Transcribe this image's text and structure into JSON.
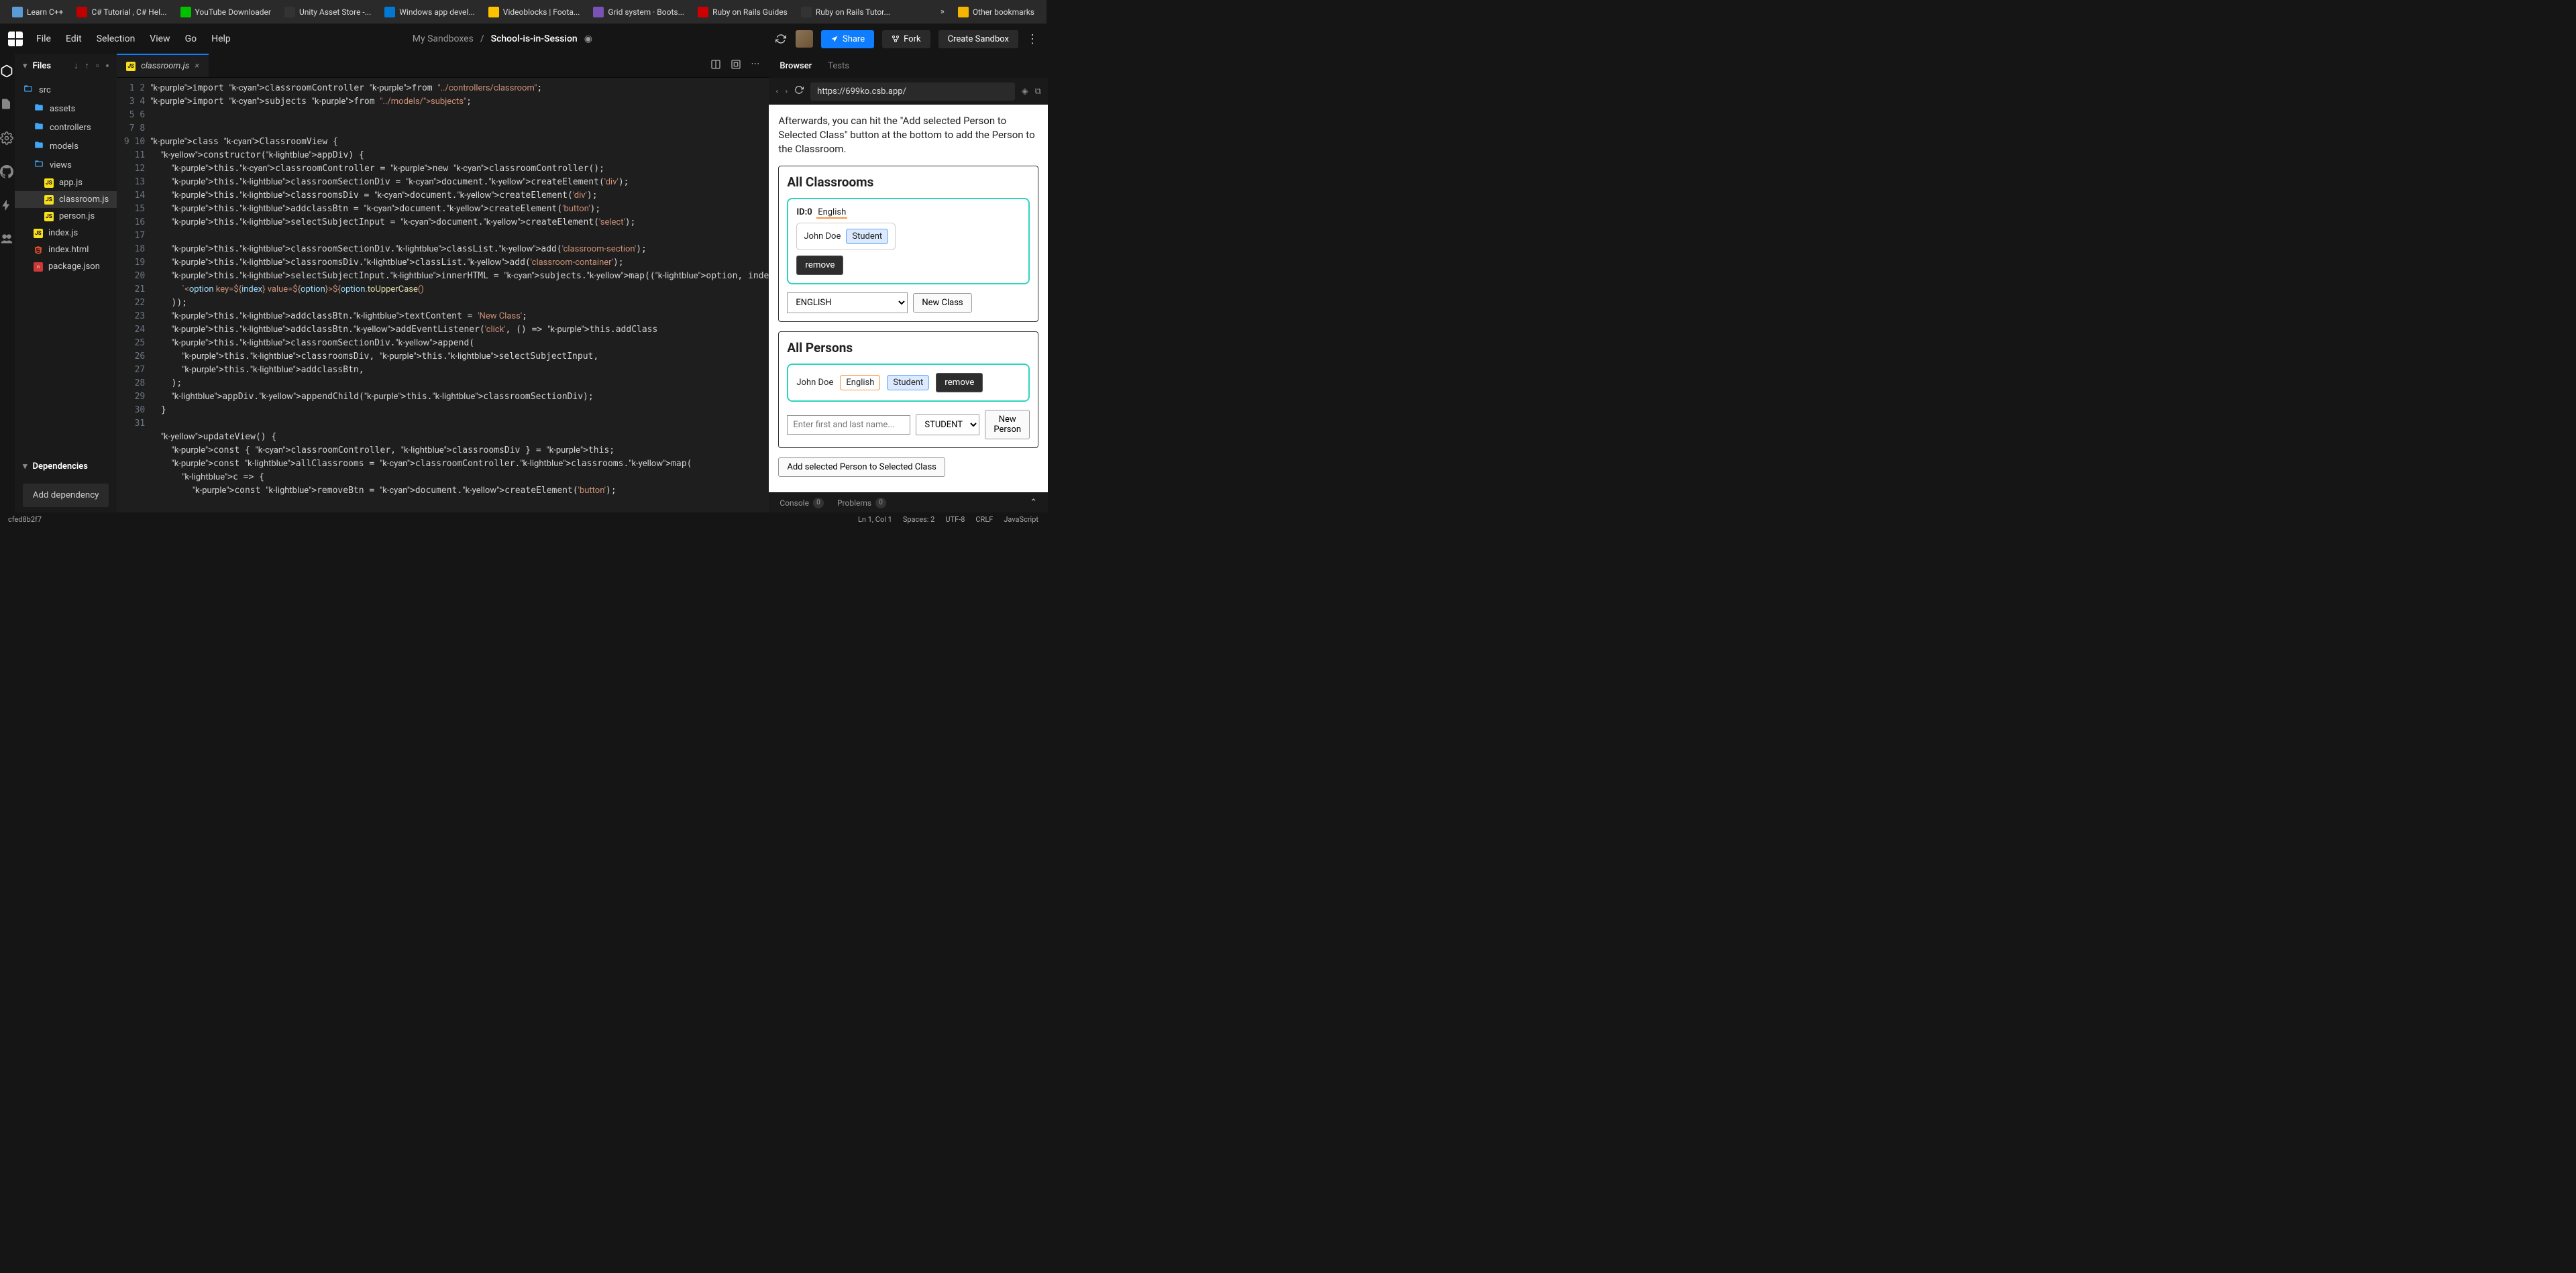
{
  "bookmarks": [
    {
      "label": "Learn C++",
      "color": "#5b9bd5"
    },
    {
      "label": "C# Tutorial , C# Hel...",
      "color": "#c00000"
    },
    {
      "label": "YouTube Downloader",
      "color": "#00c000"
    },
    {
      "label": "Unity Asset Store -...",
      "color": "#333"
    },
    {
      "label": "Windows app devel...",
      "color": "#0078d4"
    },
    {
      "label": "Videoblocks | Foota...",
      "color": "#ffc000"
    },
    {
      "label": "Grid system · Boots...",
      "color": "#7952b3"
    },
    {
      "label": "Ruby on Rails Guides",
      "color": "#cc0000"
    },
    {
      "label": "Ruby on Rails Tutor...",
      "color": "#333"
    }
  ],
  "bookmark_overflow": "»",
  "other_bookmarks": "Other bookmarks",
  "menu": {
    "items": [
      "File",
      "Edit",
      "Selection",
      "View",
      "Go",
      "Help"
    ]
  },
  "breadcrumb": {
    "parent": "My Sandboxes",
    "sep": "/",
    "current": "School-is-in-Session"
  },
  "actions": {
    "share": "Share",
    "fork": "Fork",
    "create": "Create Sandbox"
  },
  "sidebar": {
    "title": "Files",
    "tree": [
      {
        "name": "src",
        "type": "folder-open",
        "nest": 0
      },
      {
        "name": "assets",
        "type": "folder",
        "nest": 1
      },
      {
        "name": "controllers",
        "type": "folder",
        "nest": 1
      },
      {
        "name": "models",
        "type": "folder",
        "nest": 1
      },
      {
        "name": "views",
        "type": "folder-open",
        "nest": 1
      },
      {
        "name": "app.js",
        "type": "js",
        "nest": 2
      },
      {
        "name": "classroom.js",
        "type": "js",
        "nest": 2,
        "active": true
      },
      {
        "name": "person.js",
        "type": "js",
        "nest": 2
      },
      {
        "name": "index.js",
        "type": "js",
        "nest": 1
      },
      {
        "name": "index.html",
        "type": "html",
        "nest": 1
      },
      {
        "name": "package.json",
        "type": "npm",
        "nest": 1
      }
    ],
    "deps_title": "Dependencies",
    "add_dep": "Add dependency"
  },
  "tab": {
    "icon": "JS",
    "name": "classroom.js"
  },
  "code_lines": [
    "import classroomController from \"../controllers/classroom\";",
    "import subjects from \"../models/subjects\";",
    "",
    "",
    "class ClassroomView {",
    "  constructor(appDiv) {",
    "    this.classroomController = new classroomController();",
    "    this.classroomSectionDiv = document.createElement('div');",
    "    this.classroomsDiv = document.createElement('div');",
    "    this.addclassBtn = document.createElement('button');",
    "    this.selectSubjectInput = document.createElement('select');",
    "",
    "    this.classroomSectionDiv.classList.add('classroom-section');",
    "    this.classroomsDiv.classList.add('classroom-container');",
    "    this.selectSubjectInput.innerHTML = subjects.map((option, inde",
    "      `<option key=${index} value=${option}>${option.toUpperCase()",
    "    ));",
    "    this.addclassBtn.textContent = 'New Class';",
    "    this.addclassBtn.addEventListener('click', () => this.addClass",
    "    this.classroomSectionDiv.append(",
    "      this.classroomsDiv, this.selectSubjectInput,",
    "      this.addclassBtn,",
    "    );",
    "    appDiv.appendChild(this.classroomSectionDiv);",
    "  }",
    "",
    "  updateView() {",
    "    const { classroomController, classroomsDiv } = this;",
    "    const allClassrooms = classroomController.classrooms.map(",
    "      c => {",
    "        const removeBtn = document.createElement('button');"
  ],
  "preview": {
    "tabs": {
      "browser": "Browser",
      "tests": "Tests"
    },
    "url": "https://699ko.csb.app/",
    "intro": "Afterwards, you can hit the \"Add selected Person to Selected Class\" button at the bottom to add the Person to the Classroom.",
    "all_classrooms": "All Classrooms",
    "id_label": "ID:0",
    "subject": "English",
    "person": "John Doe",
    "role": "Student",
    "remove": "remove",
    "select_subject": "ENGLISH",
    "new_class": "New Class",
    "all_persons": "All Persons",
    "name_placeholder": "Enter first and last name...",
    "select_role": "STUDENT",
    "new_person": "New Person",
    "add_selected": "Add selected Person to Selected Class"
  },
  "footer": {
    "console": "Console",
    "console_count": "0",
    "problems": "Problems",
    "problems_count": "0"
  },
  "status": {
    "commit": "cfed8b2f7",
    "ln": "Ln 1, Col 1",
    "spaces": "Spaces: 2",
    "encoding": "UTF-8",
    "eol": "CRLF",
    "lang": "JavaScript"
  }
}
